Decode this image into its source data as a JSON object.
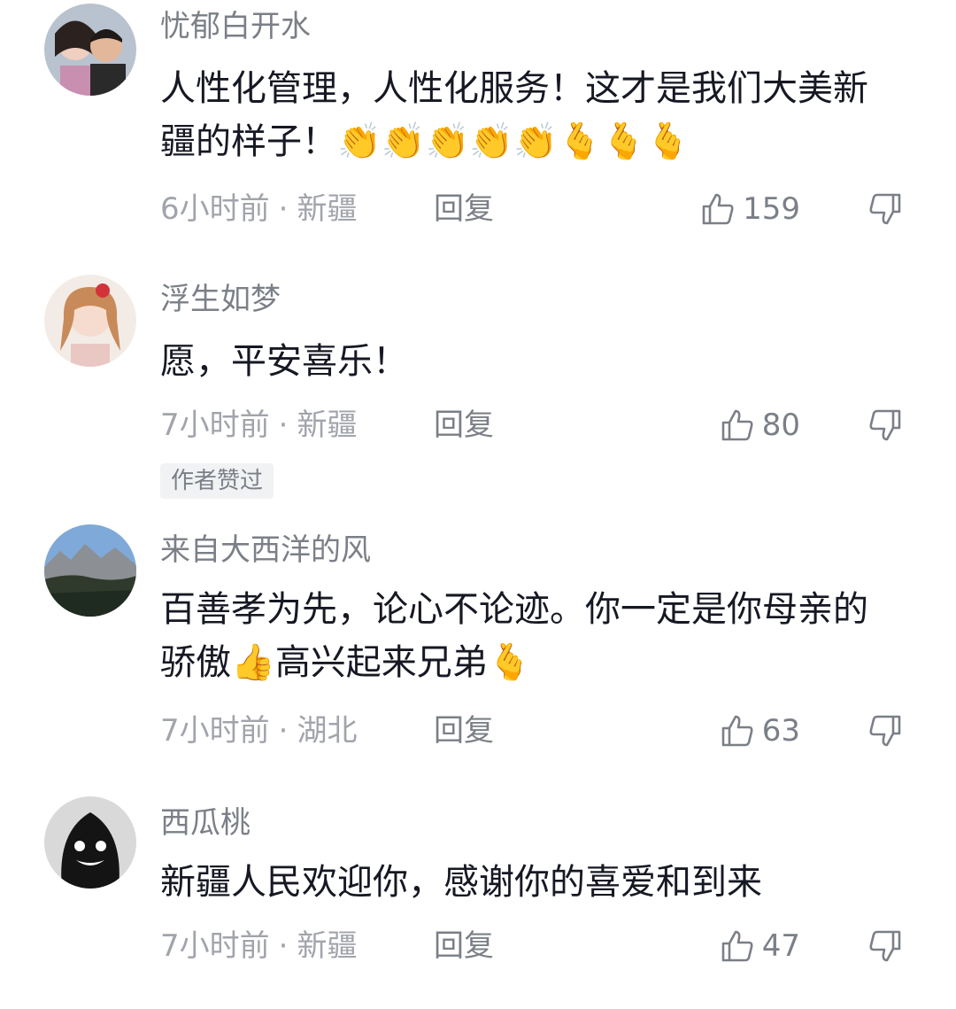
{
  "comments": [
    {
      "username": "忧郁白开水",
      "text": "人性化管理，人性化服务！这才是我们大美新疆的样子！",
      "emojis": "👏👏👏👏👏🫰🫰🫰",
      "time": "6小时前",
      "location": "新疆",
      "reply_label": "回复",
      "likes": "159"
    },
    {
      "username": "浮生如梦",
      "text": "愿，平安喜乐！",
      "emojis": "",
      "time": "7小时前",
      "location": "新疆",
      "reply_label": "回复",
      "likes": "80",
      "badge": "作者赞过"
    },
    {
      "username": "来自大西洋的风",
      "text": "百善孝为先，论心不论迹。你一定是你母亲的骄傲",
      "text_after_emoji": "高兴起来兄弟",
      "emoji_inline": "👍",
      "emoji_end": "🫰",
      "time": "7小时前",
      "location": "湖北",
      "reply_label": "回复",
      "likes": "63"
    },
    {
      "username": "西瓜桃",
      "text": "新疆人民欢迎你，感谢你的喜爱和到来",
      "time": "7小时前",
      "location": "新疆",
      "reply_label": "回复",
      "likes": "47"
    }
  ],
  "colors": {
    "username": "#7b7f87",
    "text": "#161823",
    "meta": "#a1a4ab"
  },
  "icons": {
    "like": "thumbs-up-icon",
    "dislike": "thumbs-down-icon"
  },
  "separator": "·"
}
